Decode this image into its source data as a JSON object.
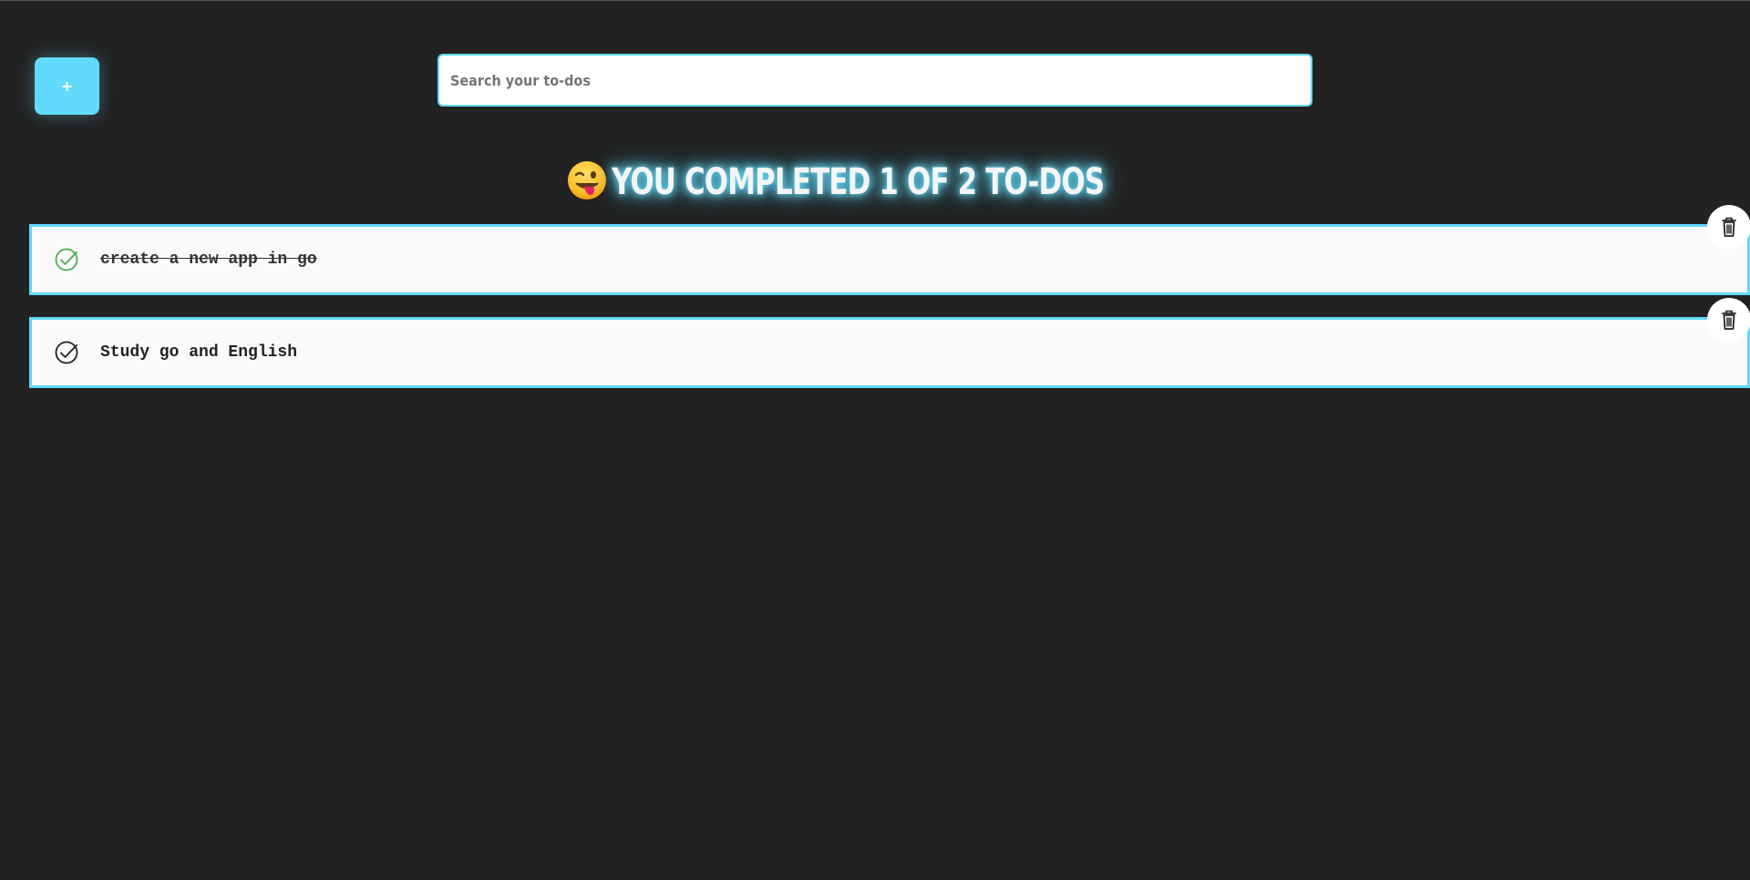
{
  "toolbar": {
    "add_label": "+"
  },
  "search": {
    "placeholder": "Search your to-dos",
    "value": ""
  },
  "counter": {
    "text": "You completed 1 of 2 To-dos"
  },
  "todos": [
    {
      "text": "create a new app in go",
      "completed": true
    },
    {
      "text": "Study go and English",
      "completed": false
    }
  ],
  "colors": {
    "background": "#222222",
    "accent": "#61dafb",
    "completed_check": "#4caf50",
    "pending_check": "#222222"
  },
  "icons": {
    "counter_emoji": "winking-face-with-tongue",
    "complete": "check-circle-icon",
    "delete": "trash-icon"
  }
}
